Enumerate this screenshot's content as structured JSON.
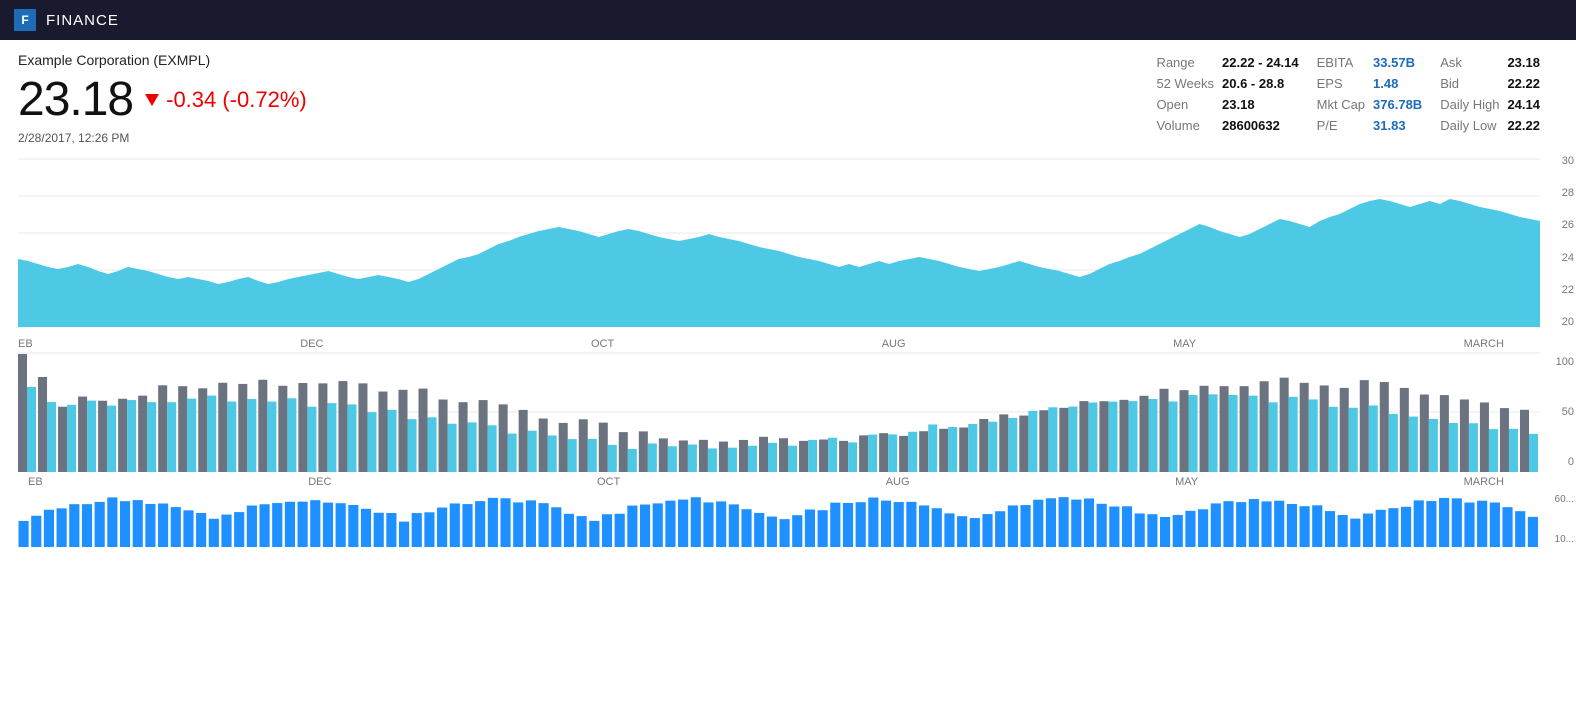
{
  "header": {
    "logo_text": "F",
    "app_title": "FINANCE"
  },
  "stock": {
    "company_name": "Example Corporation (EXMPL)",
    "price": "23.18",
    "change": "-0.34 (-0.72%)",
    "date_time": "2/28/2017, 12:26 PM"
  },
  "stats": {
    "range_label": "Range",
    "range_value": "22.22 - 24.14",
    "ebita_label": "EBITA",
    "ebita_value": "33.57B",
    "ask_label": "Ask",
    "ask_value": "23.18",
    "weeks52_label": "52 Weeks",
    "weeks52_value": "20.6 - 28.8",
    "eps_label": "EPS",
    "eps_value": "1.48",
    "bid_label": "Bid",
    "bid_value": "22.22",
    "open_label": "Open",
    "open_value": "23.18",
    "mktcap_label": "Mkt Cap",
    "mktcap_value": "376.78B",
    "daily_high_label": "Daily High",
    "daily_high_value": "24.14",
    "volume_label": "Volume",
    "volume_value": "28600632",
    "pe_label": "P/E",
    "pe_value": "31.83",
    "daily_low_label": "Daily Low",
    "daily_low_value": "22.22"
  },
  "price_chart": {
    "y_labels": [
      "30",
      "28",
      "26",
      "24",
      "22",
      "20"
    ],
    "x_labels": [
      "EB",
      "DEC",
      "OCT",
      "AUG",
      "MAY",
      "MARCH"
    ]
  },
  "indicator_chart": {
    "y_labels": [
      "100",
      "50",
      "0"
    ],
    "x_labels": [
      "EB",
      "DEC",
      "OCT",
      "AUG",
      "MAY",
      "MARCH"
    ]
  },
  "mini_chart": {
    "y_labels": [
      "60...",
      "10..."
    ]
  }
}
